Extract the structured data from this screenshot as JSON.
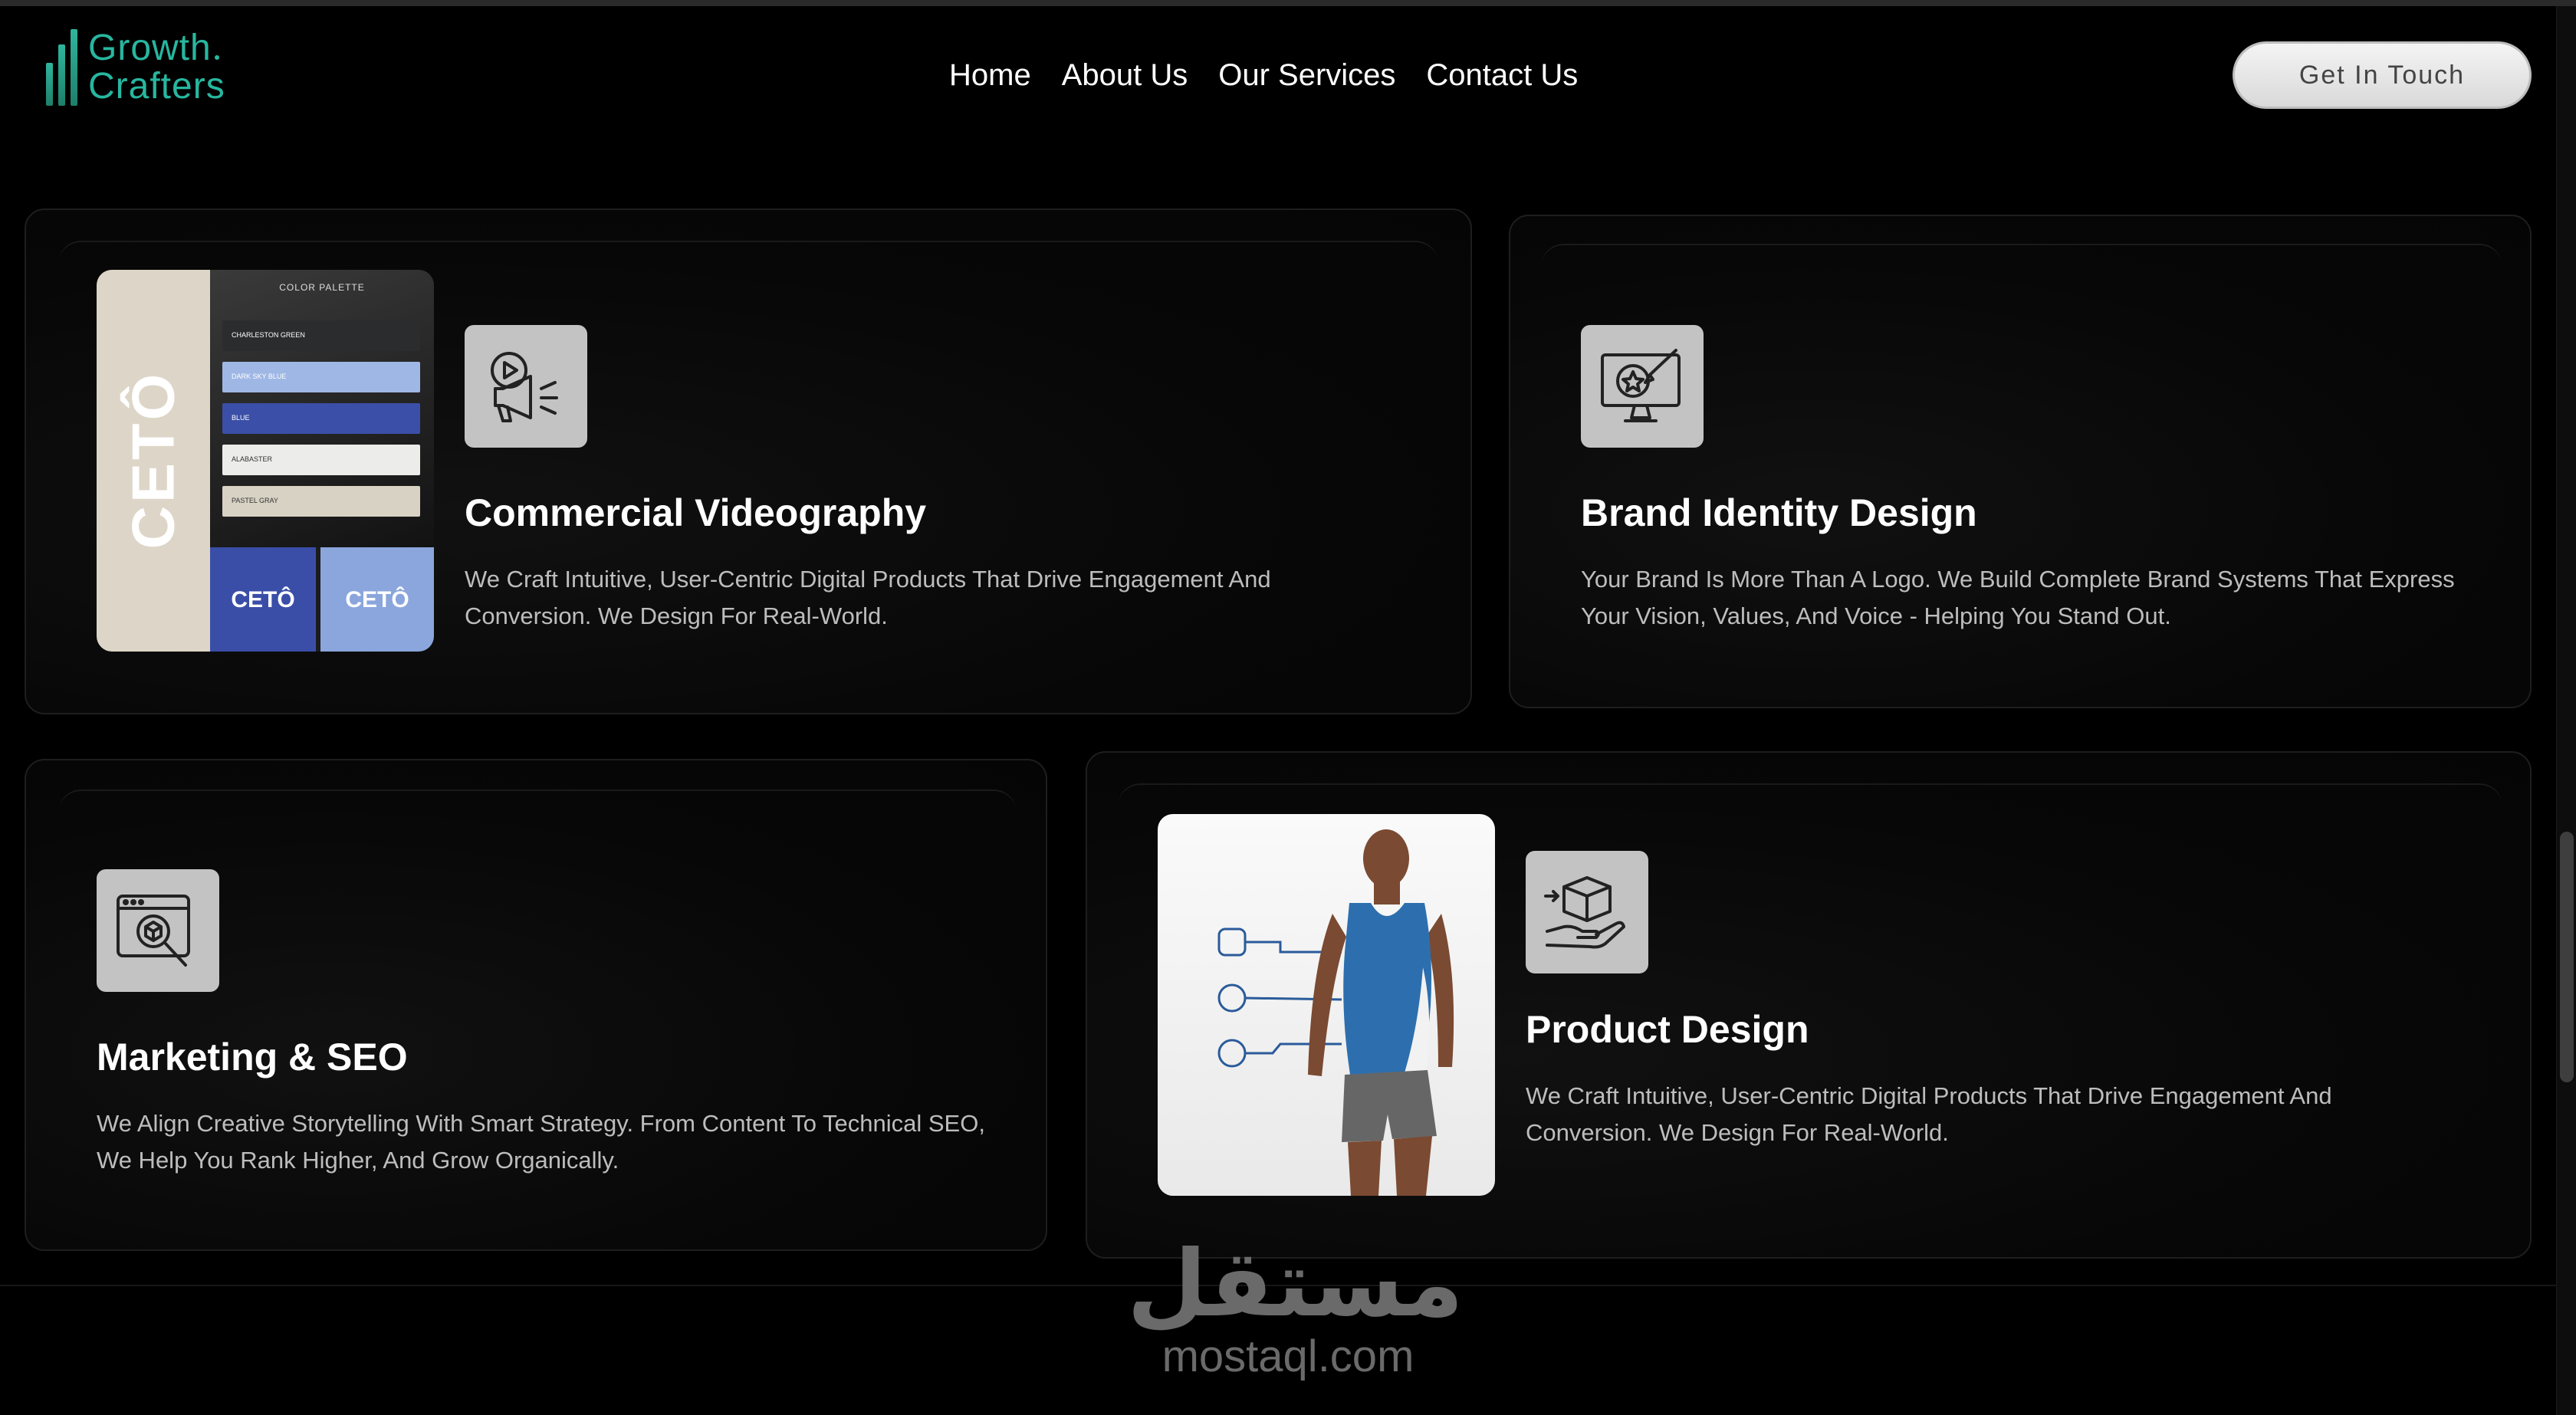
{
  "brand": {
    "line1": "Growth",
    "line2": "Crafters"
  },
  "nav": {
    "items": [
      "Home",
      "About Us",
      "Our Services",
      "Contact Us"
    ]
  },
  "cta": {
    "label": "Get In Touch"
  },
  "services": [
    {
      "title": "Commercial Videography",
      "description": "We Craft Intuitive, User-Centric Digital Products That Drive Engagement And Conversion. We Design For Real-World.",
      "icon": "megaphone-play-icon"
    },
    {
      "title": "Brand Identity Design",
      "description": "Your Brand Is More Than A Logo. We Build Complete Brand Systems That Express Your Vision, Values, And Voice - Helping You Stand Out.",
      "icon": "monitor-brush-icon"
    },
    {
      "title": "Marketing & SEO",
      "description": "We Align Creative Storytelling With Smart Strategy. From Content To Technical SEO, We Help You Rank Higher, And Grow Organically.",
      "icon": "browser-search-icon"
    },
    {
      "title": "Product Design",
      "description": "We Craft Intuitive, User-Centric Digital Products That Drive Engagement And Conversion. We Design For Real-World.",
      "icon": "hand-box-icon"
    }
  ],
  "ceto_thumb": {
    "brand": "CETÔ",
    "palette_title": "COLOR PALETTE",
    "swatches": [
      {
        "name": "CHARLESTON GREEN",
        "color": "#2b2c2e"
      },
      {
        "name": "DARK SKY BLUE",
        "color": "#9fb7e4"
      },
      {
        "name": "BLUE",
        "color": "#3b4fa8"
      },
      {
        "name": "ALABASTER",
        "color": "#ececea"
      },
      {
        "name": "PASTEL GRAY",
        "color": "#d8d2c4"
      }
    ]
  },
  "watermark": {
    "arabic": "مستقل",
    "latin": "mostaql.com"
  },
  "colors": {
    "accent": "#27b7a0",
    "background": "#000000",
    "icon_bg": "#c3c3c3"
  }
}
